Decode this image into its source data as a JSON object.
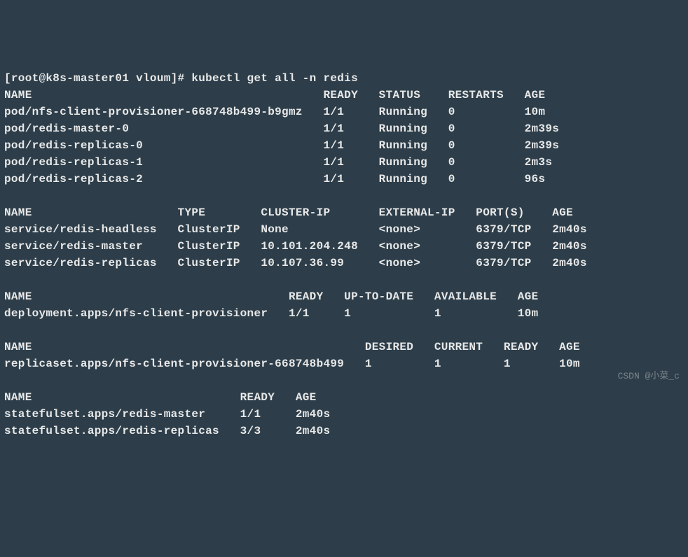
{
  "prompt": "[root@k8s-master01 vloum]# kubectl get all -n redis",
  "pods": {
    "header": "NAME                                          READY   STATUS    RESTARTS   AGE",
    "rows": [
      "pod/nfs-client-provisioner-668748b499-b9gmz   1/1     Running   0          10m",
      "pod/redis-master-0                            1/1     Running   0          2m39s",
      "pod/redis-replicas-0                          1/1     Running   0          2m39s",
      "pod/redis-replicas-1                          1/1     Running   0          2m3s",
      "pod/redis-replicas-2                          1/1     Running   0          96s"
    ]
  },
  "services": {
    "header": "NAME                     TYPE        CLUSTER-IP       EXTERNAL-IP   PORT(S)    AGE",
    "rows": [
      "service/redis-headless   ClusterIP   None             <none>        6379/TCP   2m40s",
      "service/redis-master     ClusterIP   10.101.204.248   <none>        6379/TCP   2m40s",
      "service/redis-replicas   ClusterIP   10.107.36.99     <none>        6379/TCP   2m40s"
    ]
  },
  "deployments": {
    "header": "NAME                                     READY   UP-TO-DATE   AVAILABLE   AGE",
    "rows": [
      "deployment.apps/nfs-client-provisioner   1/1     1            1           10m"
    ]
  },
  "replicasets": {
    "header": "NAME                                                DESIRED   CURRENT   READY   AGE",
    "rows": [
      "replicaset.apps/nfs-client-provisioner-668748b499   1         1         1       10m"
    ]
  },
  "statefulsets": {
    "header": "NAME                              READY   AGE",
    "rows": [
      "statefulset.apps/redis-master     1/1     2m40s",
      "statefulset.apps/redis-replicas   3/3     2m40s"
    ]
  },
  "watermark": "CSDN @小菜_c",
  "chart_data": {
    "type": "table",
    "title": "kubectl get all -n redis",
    "sections": [
      {
        "kind": "pods",
        "columns": [
          "NAME",
          "READY",
          "STATUS",
          "RESTARTS",
          "AGE"
        ],
        "rows": [
          [
            "pod/nfs-client-provisioner-668748b499-b9gmz",
            "1/1",
            "Running",
            "0",
            "10m"
          ],
          [
            "pod/redis-master-0",
            "1/1",
            "Running",
            "0",
            "2m39s"
          ],
          [
            "pod/redis-replicas-0",
            "1/1",
            "Running",
            "0",
            "2m39s"
          ],
          [
            "pod/redis-replicas-1",
            "1/1",
            "Running",
            "0",
            "2m3s"
          ],
          [
            "pod/redis-replicas-2",
            "1/1",
            "Running",
            "0",
            "96s"
          ]
        ]
      },
      {
        "kind": "services",
        "columns": [
          "NAME",
          "TYPE",
          "CLUSTER-IP",
          "EXTERNAL-IP",
          "PORT(S)",
          "AGE"
        ],
        "rows": [
          [
            "service/redis-headless",
            "ClusterIP",
            "None",
            "<none>",
            "6379/TCP",
            "2m40s"
          ],
          [
            "service/redis-master",
            "ClusterIP",
            "10.101.204.248",
            "<none>",
            "6379/TCP",
            "2m40s"
          ],
          [
            "service/redis-replicas",
            "ClusterIP",
            "10.107.36.99",
            "<none>",
            "6379/TCP",
            "2m40s"
          ]
        ]
      },
      {
        "kind": "deployments",
        "columns": [
          "NAME",
          "READY",
          "UP-TO-DATE",
          "AVAILABLE",
          "AGE"
        ],
        "rows": [
          [
            "deployment.apps/nfs-client-provisioner",
            "1/1",
            "1",
            "1",
            "10m"
          ]
        ]
      },
      {
        "kind": "replicasets",
        "columns": [
          "NAME",
          "DESIRED",
          "CURRENT",
          "READY",
          "AGE"
        ],
        "rows": [
          [
            "replicaset.apps/nfs-client-provisioner-668748b499",
            "1",
            "1",
            "1",
            "10m"
          ]
        ]
      },
      {
        "kind": "statefulsets",
        "columns": [
          "NAME",
          "READY",
          "AGE"
        ],
        "rows": [
          [
            "statefulset.apps/redis-master",
            "1/1",
            "2m40s"
          ],
          [
            "statefulset.apps/redis-replicas",
            "3/3",
            "2m40s"
          ]
        ]
      }
    ]
  }
}
